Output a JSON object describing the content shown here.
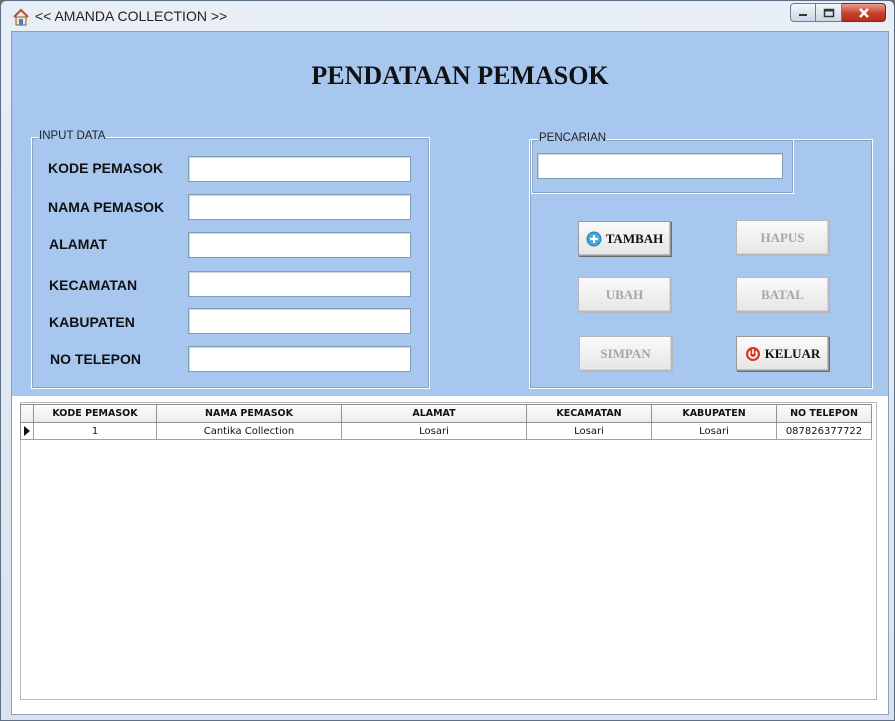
{
  "window": {
    "title": "<< AMANDA COLLECTION >>",
    "controls": {
      "minimize": "minimize-icon",
      "maximize": "maximize-icon",
      "close": "close-icon"
    }
  },
  "page": {
    "title": "PENDATAAN PEMASOK"
  },
  "input_group": {
    "legend": "INPUT DATA",
    "fields": [
      {
        "label": "KODE PEMASOK",
        "value": ""
      },
      {
        "label": "NAMA PEMASOK",
        "value": ""
      },
      {
        "label": "ALAMAT",
        "value": ""
      },
      {
        "label": "KECAMATAN",
        "value": ""
      },
      {
        "label": "KABUPATEN",
        "value": ""
      },
      {
        "label": "NO TELEPON",
        "value": ""
      }
    ]
  },
  "search_group": {
    "legend": "PENCARIAN",
    "value": ""
  },
  "buttons": {
    "tambah": {
      "label": "TAMBAH",
      "icon": "add-icon",
      "enabled": true
    },
    "hapus": {
      "label": "HAPUS",
      "enabled": false
    },
    "ubah": {
      "label": "UBAH",
      "enabled": false
    },
    "batal": {
      "label": "BATAL",
      "enabled": false
    },
    "simpan": {
      "label": "SIMPAN",
      "enabled": false
    },
    "keluar": {
      "label": "KELUAR",
      "icon": "power-icon",
      "enabled": true
    }
  },
  "table": {
    "columns": [
      "KODE PEMASOK",
      "NAMA PEMASOK",
      "ALAMAT",
      "KECAMATAN",
      "KABUPATEN",
      "NO TELEPON"
    ],
    "rows": [
      [
        "1",
        "Cantika Collection",
        "Losari",
        "Losari",
        "Losari",
        "087826377722"
      ]
    ]
  },
  "colors": {
    "form_background": "#a8c7ef",
    "close_button": "#c3412b"
  }
}
